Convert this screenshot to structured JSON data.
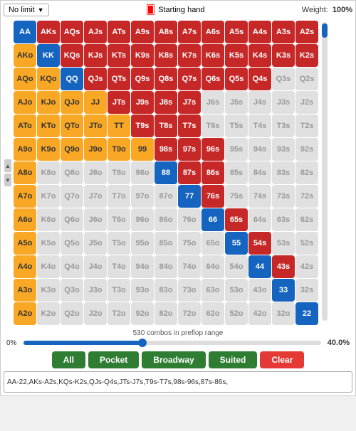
{
  "topbar": {
    "dropdown_label": "No limit",
    "dropdown_arrow": "▼",
    "starting_hand": "Starting hand",
    "weight_label": "Weight:",
    "weight_value": "100%"
  },
  "slider": {
    "combo_info": "530 combos in preflop range",
    "pct": "40.0%",
    "zero_label": "0%",
    "value": 40
  },
  "buttons": [
    {
      "id": "all",
      "label": "All",
      "type": "green"
    },
    {
      "id": "pocket",
      "label": "Pocket",
      "type": "green"
    },
    {
      "id": "broadway",
      "label": "Broadway",
      "type": "green"
    },
    {
      "id": "suited",
      "label": "Suited",
      "type": "green"
    },
    {
      "id": "clear",
      "label": "Clear",
      "type": "clear"
    }
  ],
  "range_text": "AA-22,AKs-A2s,KQs-K2s,QJs-Q4s,JTs-J7s,T9s-T7s,98s-96s,87s-86s,",
  "grid": {
    "ranks": [
      "A",
      "K",
      "Q",
      "J",
      "T",
      "9",
      "8",
      "7",
      "6",
      "5",
      "4",
      "3",
      "2"
    ],
    "cells": [
      [
        "AA",
        "AKs",
        "AQs",
        "AJs",
        "ATs",
        "A9s",
        "A8s",
        "A7s",
        "A6s",
        "A5s",
        "A4s",
        "A3s",
        "A2s"
      ],
      [
        "AKo",
        "KK",
        "KQs",
        "KJs",
        "KTs",
        "K9s",
        "K8s",
        "K7s",
        "K6s",
        "K5s",
        "K4s",
        "K3s",
        "K2s"
      ],
      [
        "AQo",
        "KQo",
        "QQ",
        "QJs",
        "QTs",
        "Q9s",
        "Q8s",
        "Q7s",
        "Q6s",
        "Q5s",
        "Q4s",
        "Q3s",
        "Q2s"
      ],
      [
        "AJo",
        "KJo",
        "QJo",
        "JJ",
        "JTs",
        "J9s",
        "J8s",
        "J7s",
        "J6s",
        "J5s",
        "J4s",
        "J3s",
        "J2s"
      ],
      [
        "ATo",
        "KTo",
        "QTo",
        "JTo",
        "TT",
        "T9s",
        "T8s",
        "T7s",
        "T6s",
        "T5s",
        "T4s",
        "T3s",
        "T2s"
      ],
      [
        "A9o",
        "K9o",
        "Q9o",
        "J9o",
        "T9o",
        "99",
        "98s",
        "97s",
        "96s",
        "95s",
        "94s",
        "93s",
        "92s"
      ],
      [
        "A8o",
        "K8o",
        "Q8o",
        "J8o",
        "T8o",
        "98o",
        "88",
        "87s",
        "86s",
        "85s",
        "84s",
        "83s",
        "82s"
      ],
      [
        "A7o",
        "K7o",
        "Q7o",
        "J7o",
        "T7o",
        "97o",
        "87o",
        "77",
        "76s",
        "75s",
        "74s",
        "73s",
        "72s"
      ],
      [
        "A6o",
        "K6o",
        "Q6o",
        "J6o",
        "T6o",
        "96o",
        "86o",
        "76o",
        "66",
        "65s",
        "64s",
        "63s",
        "62s"
      ],
      [
        "A5o",
        "K5o",
        "Q5o",
        "J5o",
        "T5o",
        "95o",
        "85o",
        "75o",
        "65o",
        "55",
        "54s",
        "53s",
        "52s"
      ],
      [
        "A4o",
        "K4o",
        "Q4o",
        "J4o",
        "T4o",
        "94o",
        "84o",
        "74o",
        "64o",
        "54o",
        "44",
        "43s",
        "42s"
      ],
      [
        "A3o",
        "K3o",
        "Q3o",
        "J3o",
        "T3o",
        "93o",
        "83o",
        "73o",
        "63o",
        "53o",
        "43o",
        "33",
        "32s"
      ],
      [
        "A2o",
        "K2o",
        "Q2o",
        "J2o",
        "T2o",
        "92o",
        "82o",
        "72o",
        "62o",
        "52o",
        "42o",
        "32o",
        "22"
      ]
    ],
    "colors": [
      [
        "pair-blue",
        "suited-red",
        "suited-red",
        "suited-red",
        "suited-red",
        "suited-red",
        "suited-red",
        "suited-red",
        "suited-red",
        "suited-red",
        "suited-red",
        "suited-red",
        "suited-red"
      ],
      [
        "offsuit-gold",
        "pair-blue",
        "suited-red",
        "suited-red",
        "suited-red",
        "suited-red",
        "suited-red",
        "suited-red",
        "suited-red",
        "suited-red",
        "suited-red",
        "suited-red",
        "suited-red"
      ],
      [
        "offsuit-gold",
        "offsuit-gold",
        "pair-blue",
        "suited-red",
        "suited-red",
        "suited-red",
        "suited-red",
        "suited-red",
        "suited-red",
        "suited-red",
        "suited-red",
        "gray",
        "gray"
      ],
      [
        "offsuit-gold",
        "offsuit-gold",
        "offsuit-gold",
        "pair-yellow",
        "suited-red",
        "suited-red",
        "suited-red",
        "suited-red",
        "gray",
        "gray",
        "gray",
        "gray",
        "gray"
      ],
      [
        "offsuit-gold",
        "offsuit-gold",
        "offsuit-gold",
        "offsuit-gold",
        "pair-yellow",
        "suited-red",
        "suited-red",
        "suited-red",
        "gray",
        "gray",
        "gray",
        "gray",
        "gray"
      ],
      [
        "offsuit-gold",
        "offsuit-gold",
        "offsuit-gold",
        "offsuit-gold",
        "offsuit-gold",
        "pair-yellow",
        "suited-red",
        "suited-red",
        "suited-red",
        "gray",
        "gray",
        "gray",
        "gray"
      ],
      [
        "offsuit-gold",
        "gray",
        "gray",
        "gray",
        "gray",
        "gray",
        "pair-blue",
        "suited-red",
        "suited-red",
        "gray",
        "gray",
        "gray",
        "gray"
      ],
      [
        "offsuit-gold",
        "gray",
        "gray",
        "gray",
        "gray",
        "gray",
        "gray",
        "pair-blue",
        "suited-red",
        "gray",
        "gray",
        "gray",
        "gray"
      ],
      [
        "offsuit-gold",
        "gray",
        "gray",
        "gray",
        "gray",
        "gray",
        "gray",
        "gray",
        "pair-blue",
        "suited-red",
        "gray",
        "gray",
        "gray"
      ],
      [
        "offsuit-gold",
        "gray",
        "gray",
        "gray",
        "gray",
        "gray",
        "gray",
        "gray",
        "gray",
        "pair-blue",
        "suited-red",
        "gray",
        "gray"
      ],
      [
        "offsuit-gold",
        "gray",
        "gray",
        "gray",
        "gray",
        "gray",
        "gray",
        "gray",
        "gray",
        "gray",
        "pair-blue",
        "suited-red",
        "gray"
      ],
      [
        "offsuit-gold",
        "gray",
        "gray",
        "gray",
        "gray",
        "gray",
        "gray",
        "gray",
        "gray",
        "gray",
        "gray",
        "pair-blue",
        "gray"
      ],
      [
        "offsuit-gold",
        "gray",
        "gray",
        "gray",
        "gray",
        "gray",
        "gray",
        "gray",
        "gray",
        "gray",
        "gray",
        "gray",
        "pair-blue"
      ]
    ]
  }
}
